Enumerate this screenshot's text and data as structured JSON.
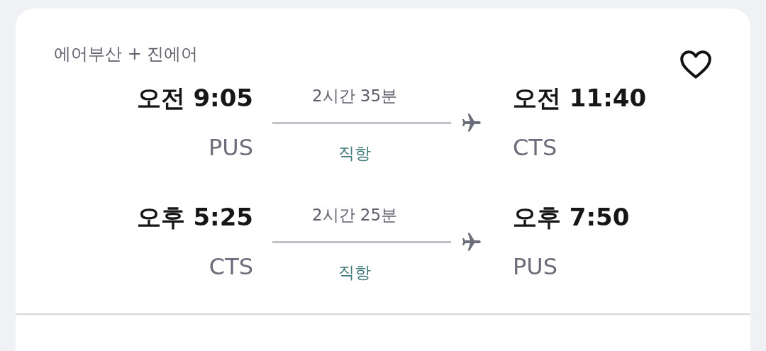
{
  "card": {
    "airlines": "에어부산 + 진에어",
    "saved": false,
    "legs": [
      {
        "depart_time": "오전 9:05",
        "depart_code": "PUS",
        "duration": "2시간 35분",
        "stops": "직항",
        "arrive_time": "오전 11:40",
        "arrive_code": "CTS"
      },
      {
        "depart_time": "오후 5:25",
        "depart_code": "CTS",
        "duration": "2시간 25분",
        "stops": "직항",
        "arrive_time": "오후 7:50",
        "arrive_code": "PUS"
      }
    ]
  }
}
